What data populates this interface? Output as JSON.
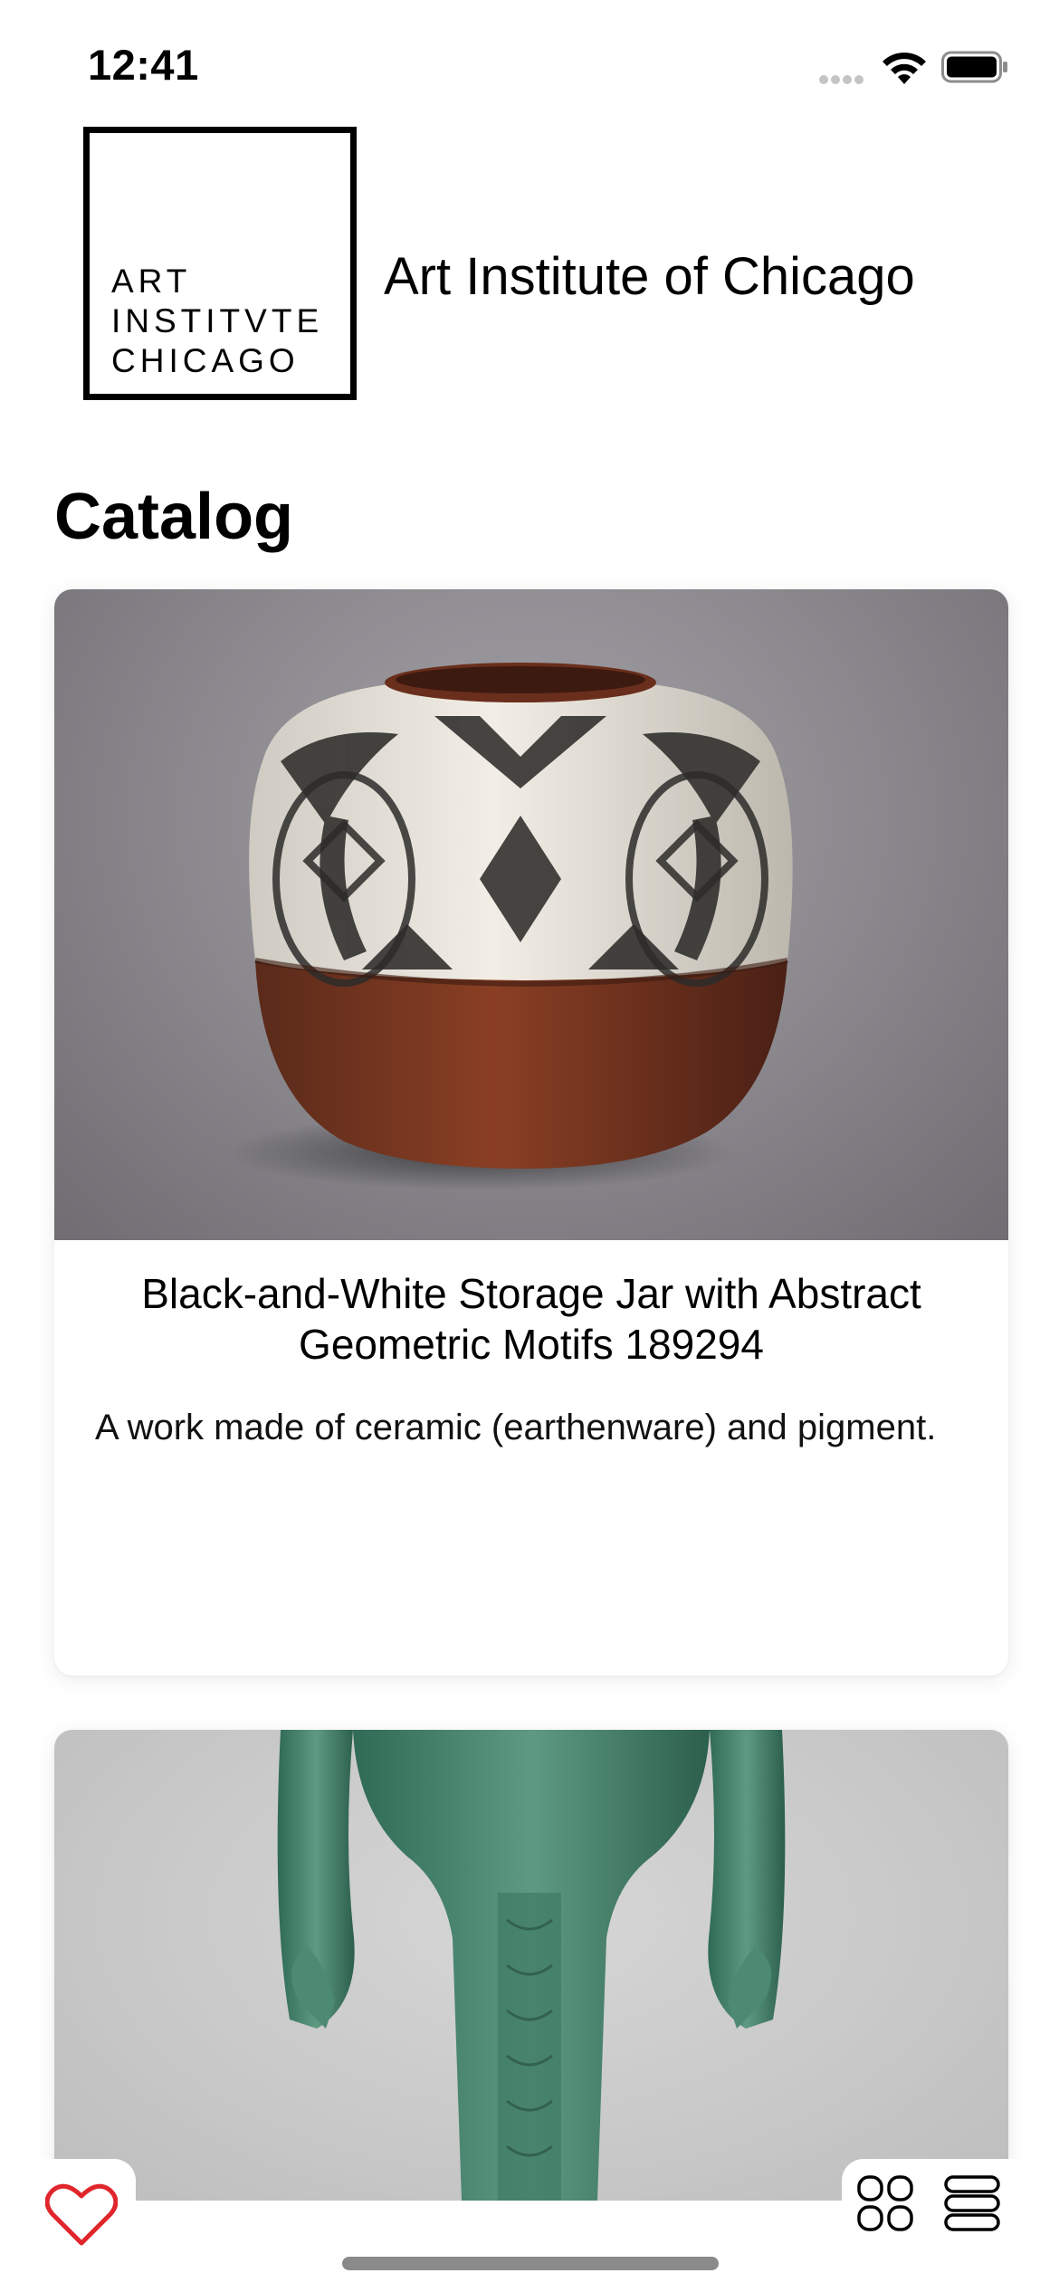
{
  "status_bar": {
    "time": "12:41",
    "signal_icon": "signal-dots-icon",
    "wifi_icon": "wifi-icon",
    "battery_icon": "battery-icon"
  },
  "header": {
    "logo_lines": [
      "ART",
      "INSTITVTE",
      "CHICAGO"
    ],
    "title": "Art Institute of Chicago"
  },
  "catalog": {
    "title": "Catalog",
    "items": [
      {
        "image_icon": "ceramic-jar-image",
        "title": "Black-and-White Storage Jar with Abstract Geometric Motifs 189294",
        "description": "A work made of ceramic (earthenware) and pigment."
      },
      {
        "image_icon": "bronze-statue-image"
      }
    ]
  },
  "bottom_bar": {
    "favorites_icon": "heart-icon",
    "grid_view_icon": "grid-view-icon",
    "list_view_icon": "list-view-icon"
  },
  "colors": {
    "heart": "#e0262c",
    "card_image_bg_1": "#8e8c91",
    "card_image_bg_2": "#c8c8c8",
    "home_indicator": "#8a8a8a"
  }
}
